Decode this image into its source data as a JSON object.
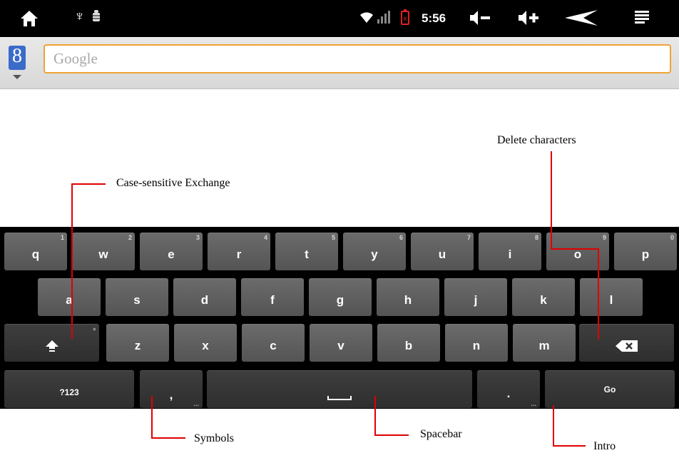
{
  "status_bar": {
    "clock": "5:56",
    "icons": [
      "home-icon",
      "usb-icon",
      "debug-icon",
      "wifi-icon",
      "signal-icon",
      "battery-low-icon",
      "volume-down-icon",
      "volume-up-icon",
      "back-icon",
      "menu-icon"
    ]
  },
  "search": {
    "logo_letter": "8",
    "placeholder": "Google"
  },
  "annotations": {
    "case": "Case-sensitive Exchange",
    "delete": "Delete characters",
    "symbols": "Symbols",
    "spacebar": "Spacebar",
    "intro": "Intro"
  },
  "keyboard": {
    "row1": [
      {
        "label": "q",
        "hint": "1"
      },
      {
        "label": "w",
        "hint": "2"
      },
      {
        "label": "e",
        "hint": "3"
      },
      {
        "label": "r",
        "hint": "4"
      },
      {
        "label": "t",
        "hint": "5"
      },
      {
        "label": "y",
        "hint": "6"
      },
      {
        "label": "u",
        "hint": "7"
      },
      {
        "label": "i",
        "hint": "8"
      },
      {
        "label": "o",
        "hint": "9"
      },
      {
        "label": "p",
        "hint": "0"
      }
    ],
    "row2": [
      {
        "label": "a"
      },
      {
        "label": "s"
      },
      {
        "label": "d"
      },
      {
        "label": "f"
      },
      {
        "label": "g"
      },
      {
        "label": "h"
      },
      {
        "label": "j"
      },
      {
        "label": "k"
      },
      {
        "label": "l"
      }
    ],
    "row3": [
      {
        "label": "z"
      },
      {
        "label": "x"
      },
      {
        "label": "c"
      },
      {
        "label": "v"
      },
      {
        "label": "b"
      },
      {
        "label": "n"
      },
      {
        "label": "m"
      }
    ],
    "symbols_label": "?123",
    "comma_label": ",",
    "period_label": ".",
    "go_label": "Go",
    "more_hint": "..."
  },
  "colors": {
    "accent_orange": "#f0a334",
    "annotation_red": "#e00000",
    "google_blue": "#3b6bc9"
  }
}
